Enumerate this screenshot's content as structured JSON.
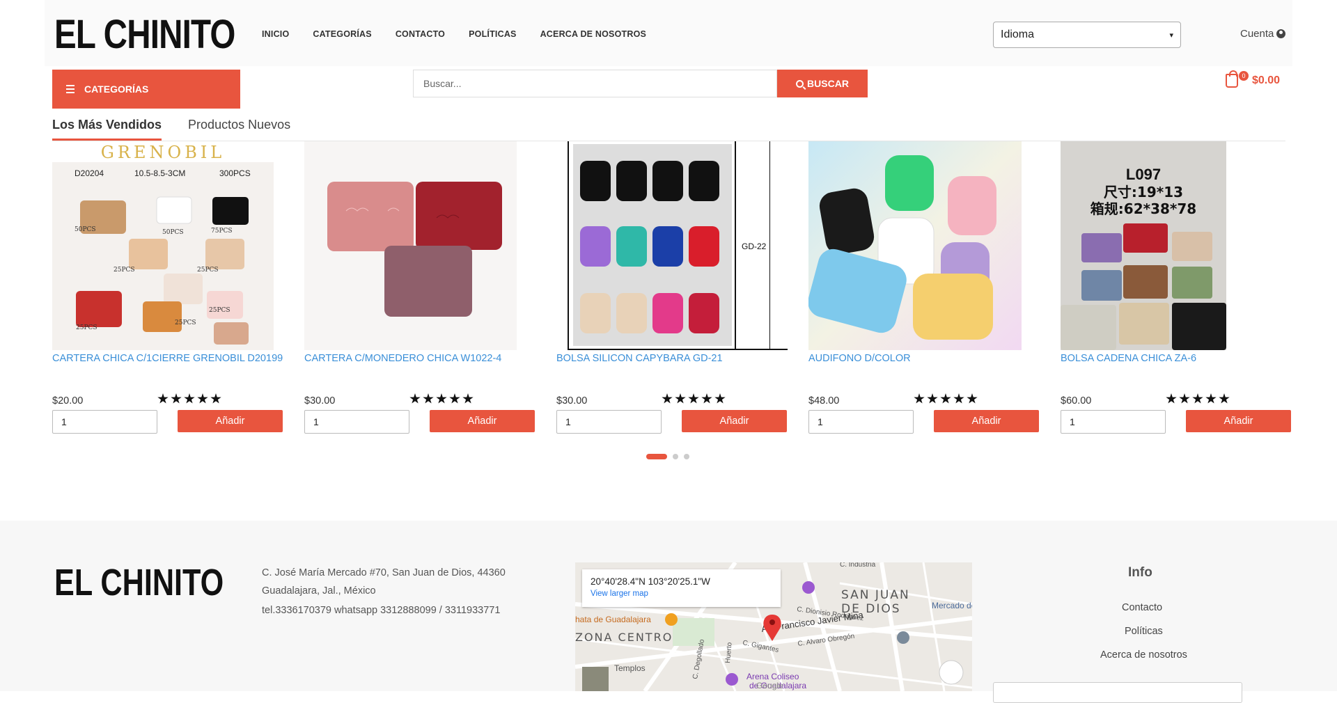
{
  "header": {
    "logo": "EL CHINITO",
    "nav": [
      "INICIO",
      "CATEGORÍAS",
      "CONTACTO",
      "POLÍTICAS",
      "ACERCA DE NOSOTROS"
    ],
    "language": "Idioma",
    "account": "Cuenta",
    "categories_button": "CATEGORÍAS",
    "search_placeholder": "Buscar...",
    "search_button": "BUSCAR",
    "cart_count": "0",
    "cart_total": "$0.00"
  },
  "tabs": [
    "Los Más Vendidos",
    "Productos Nuevos"
  ],
  "products": [
    {
      "title": "CARTERA CHICA C/1CIERRE GRENOBIL D20199",
      "price": "$20.00",
      "qty": "1",
      "add": "Añadir",
      "rating": 5
    },
    {
      "title": "CARTERA C/MONEDERO CHICA W1022-4",
      "price": "$30.00",
      "qty": "1",
      "add": "Añadir",
      "rating": 5
    },
    {
      "title": "BOLSA SILICON CAPYBARA GD-21",
      "price": "$30.00",
      "qty": "1",
      "add": "Añadir",
      "rating": 5
    },
    {
      "title": "AUDIFONO D/COLOR",
      "price": "$48.00",
      "qty": "1",
      "add": "Añadir",
      "rating": 5
    },
    {
      "title": "BOLSA CADENA CHICA ZA-6",
      "price": "$60.00",
      "qty": "1",
      "add": "Añadir",
      "rating": 5
    }
  ],
  "product_images": {
    "p1": {
      "brand": "GRENOBIL",
      "code": "D20204",
      "size": "10.5-8.5-3CM",
      "pcs": "300PCS",
      "l50a": "50PCS",
      "l50b": "50PCS",
      "l75": "75PCS",
      "l25a": "25PCS",
      "l25b": "25PCS",
      "l25c": "25PCS",
      "l25d": "25PCS",
      "l25e": "25PCS"
    },
    "p3": {
      "label": "GD-22"
    },
    "p5": {
      "code": "L097",
      "dims": "尺寸:19*13",
      "box": "箱规:62*38*78"
    }
  },
  "carousel": {
    "pages": 3,
    "active": 0
  },
  "footer": {
    "logo": "EL CHINITO",
    "address1": "C. José María Mercado #70, San Juan de Dios, 44360",
    "address2": "Guadalajara, Jal., México",
    "tel": "tel.3336170379 whatsapp 3312888099 / 3311933771",
    "map": {
      "coords": "20°40'28.4\"N 103°20'25.1\"W",
      "link": "View larger map",
      "labels": {
        "san_juan": "SAN JUAN",
        "de_dios": "DE DIOS",
        "zona_centro": "ZONA CENTRO",
        "mercado": "Mercado de",
        "teatro": "hata de Guadalajara",
        "templos": "Templos",
        "arena": "Arena Coliseo",
        "arena2": "de Guadalajara",
        "av_mina": "Av. Francisco Javier Mina",
        "dionisio": "C. Dionisio Rodriguez",
        "obregon": "C. Alvaro Obregón",
        "gigantes": "C. Gigantes",
        "degollado": "C. Degollado",
        "huerto": "Huerto",
        "industria": "C. Industria",
        "google": "Google"
      }
    },
    "info_title": "Info",
    "links": [
      "Contacto",
      "Políticas",
      "Acerca de nosotros"
    ]
  },
  "colors": {
    "accent": "#e8553e",
    "link": "#3a8fd8"
  }
}
